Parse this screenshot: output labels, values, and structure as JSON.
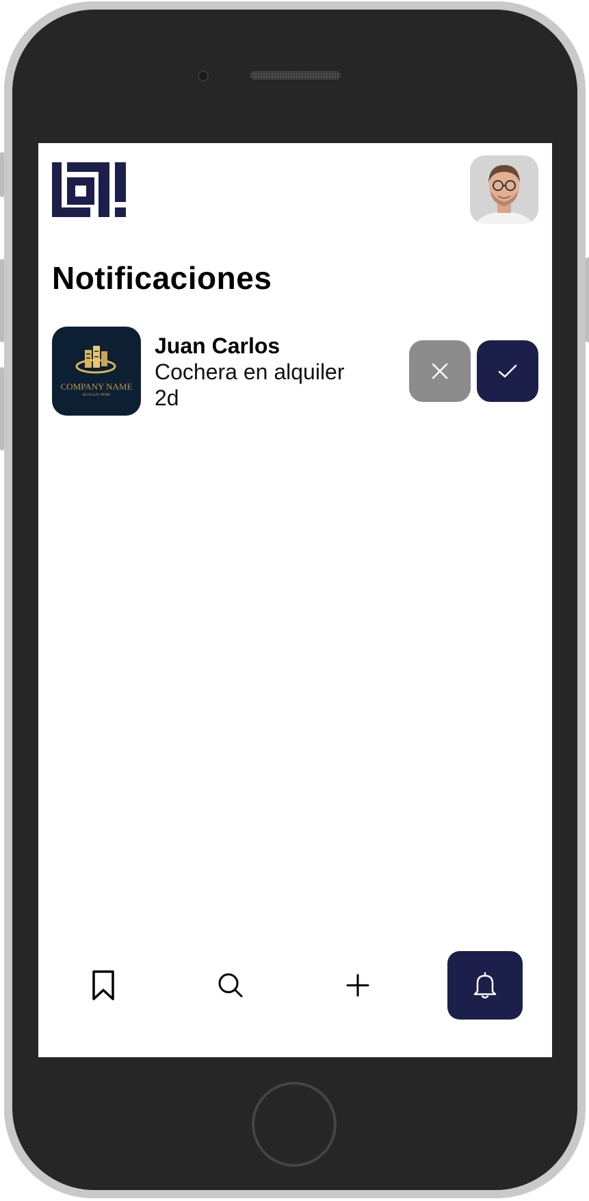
{
  "app": {
    "logo_icon": "loti-logo-icon",
    "brand_color": "#1c1f4a"
  },
  "header": {
    "avatar_icon": "user-avatar"
  },
  "page": {
    "title": "Notificaciones"
  },
  "notifications": [
    {
      "name": "Juan Carlos",
      "message": "Cochera en alquiler",
      "time": "2d",
      "thumbnail": {
        "company": "COMPANY NAME",
        "slogan": "SLOGAN HERE"
      },
      "reject_icon": "close-icon",
      "accept_icon": "check-icon"
    }
  ],
  "bottom_nav": {
    "items": [
      {
        "icon": "bookmark-icon",
        "active": false
      },
      {
        "icon": "search-icon",
        "active": false
      },
      {
        "icon": "plus-icon",
        "active": false
      },
      {
        "icon": "bell-icon",
        "active": true
      }
    ]
  },
  "colors": {
    "reject_button": "#8c8c8c",
    "accept_button": "#1c1f4a",
    "thumbnail_bg": "#0d1f33",
    "thumbnail_gold": "#d8b65e"
  }
}
